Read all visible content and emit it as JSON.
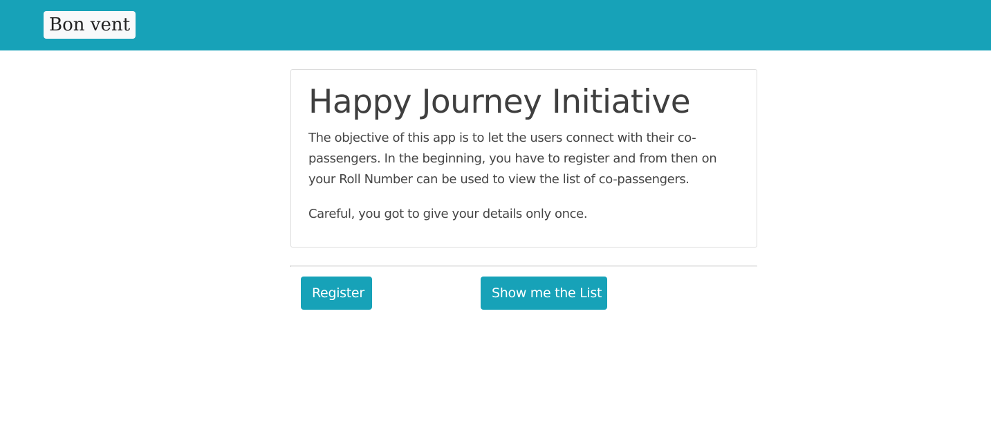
{
  "navbar": {
    "brand": "Bon vent",
    "background_color": "#17a2b8"
  },
  "jumbotron": {
    "title": "Happy Journey Initiative",
    "description": "The objective of this app is to let the users connect with their co-passengers. In the beginning, you have to register and from then on your Roll Number can be used to view the list of co-passengers.",
    "note": "Careful, you got to give your details only once."
  },
  "actions": {
    "register_label": "Register",
    "show_list_label": "Show me the List",
    "button_color": "#17a2b8"
  }
}
